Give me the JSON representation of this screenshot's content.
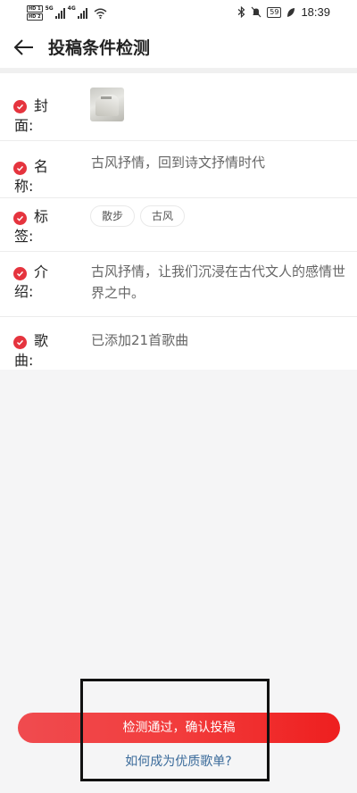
{
  "status_bar": {
    "hd1": "HD 1",
    "hd2": "HD 2",
    "net1": "5G",
    "net2": "4G",
    "battery": "59",
    "time": "18:39"
  },
  "header": {
    "title": "投稿条件检测"
  },
  "rows": [
    {
      "label_1": "封",
      "label_2": "面:"
    },
    {
      "label_1": "名",
      "label_2": "称:",
      "value": "古风抒情，回到诗文抒情时代"
    },
    {
      "label_1": "标",
      "label_2": "签:",
      "tags": [
        "散步",
        "古风"
      ]
    },
    {
      "label_1": "介",
      "label_2": "绍:",
      "value": "古风抒情，让我们沉浸在古代文人的感情世界之中。"
    },
    {
      "label_1": "歌",
      "label_2": "曲:",
      "value": "已添加21首歌曲"
    }
  ],
  "actions": {
    "confirm_label": "检测通过，确认投稿",
    "help_link": "如何成为优质歌单?"
  },
  "colors": {
    "accent": "#e5343e",
    "link": "#3a6a9a",
    "background": "#f5f5f6"
  }
}
